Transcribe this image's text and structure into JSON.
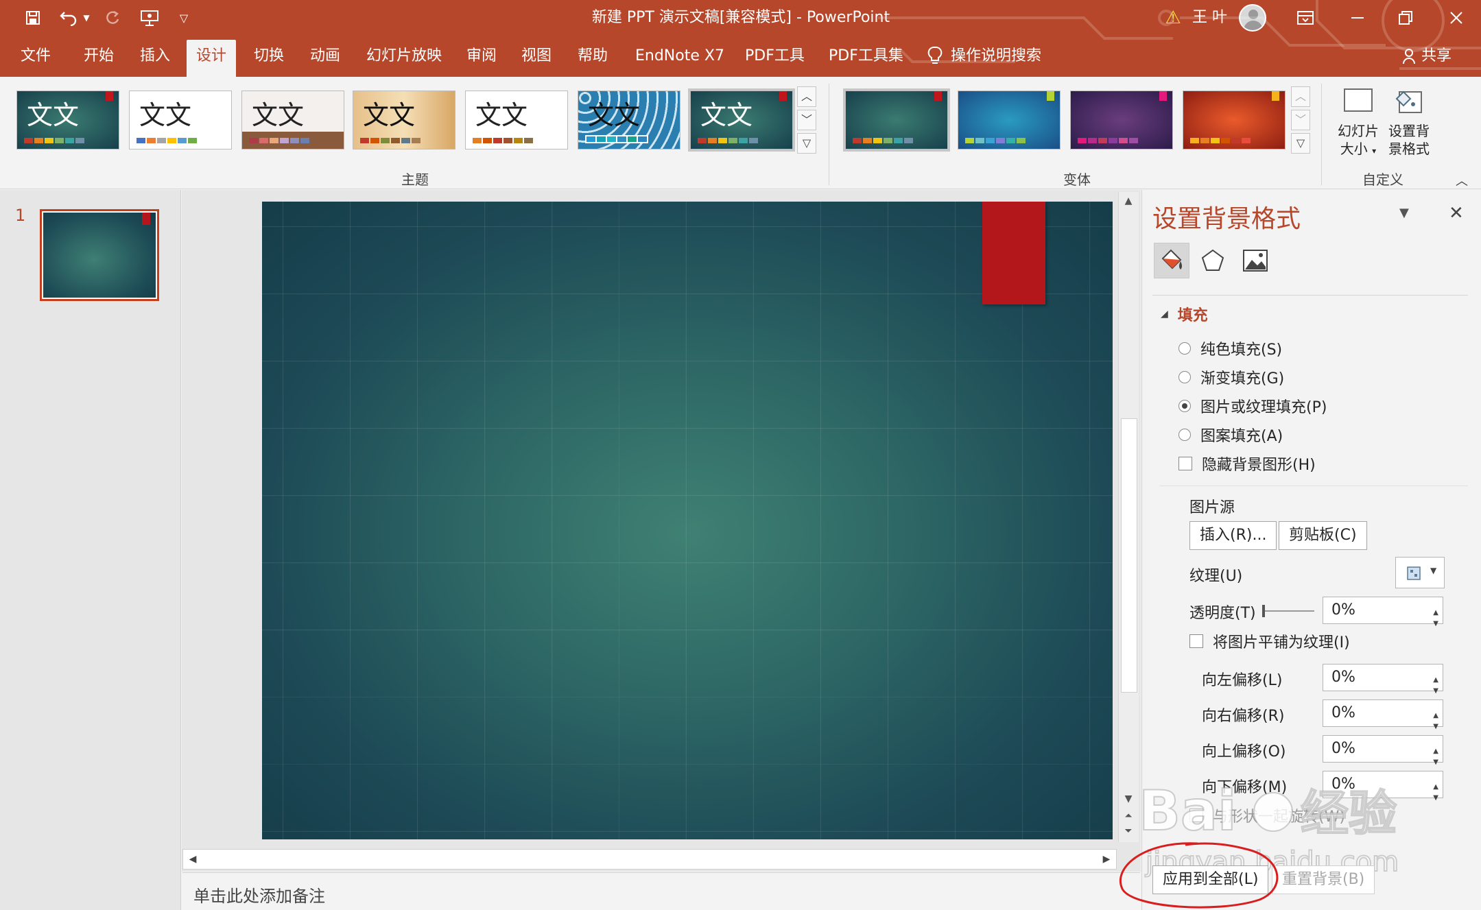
{
  "title_bar": {
    "document_title": "新建 PPT 演示文稿[兼容模式]  -  PowerPoint",
    "user_name": "王 叶",
    "quick_access": [
      "save-icon",
      "undo-icon",
      "redo-icon",
      "present-from-start-icon",
      "customize-qat-icon"
    ],
    "window_controls": [
      "ribbon-display-options-icon",
      "minimize-icon",
      "restore-icon",
      "close-icon"
    ]
  },
  "tabs": [
    {
      "label": "文件",
      "active": false
    },
    {
      "label": "开始",
      "active": false
    },
    {
      "label": "插入",
      "active": false
    },
    {
      "label": "设计",
      "active": true
    },
    {
      "label": "切换",
      "active": false
    },
    {
      "label": "动画",
      "active": false
    },
    {
      "label": "幻灯片放映",
      "active": false
    },
    {
      "label": "审阅",
      "active": false
    },
    {
      "label": "视图",
      "active": false
    },
    {
      "label": "帮助",
      "active": false
    },
    {
      "label": "EndNote X7",
      "active": false
    },
    {
      "label": "PDF工具",
      "active": false
    },
    {
      "label": "PDF工具集",
      "active": false
    }
  ],
  "tell_me": "操作说明搜索",
  "share": "共享",
  "ribbon": {
    "themes_group_label": "主题",
    "variants_group_label": "变体",
    "customize_group_label": "自定义",
    "theme_text": "文文",
    "slide_size_label_1": "幻灯片",
    "slide_size_label_2": "大小",
    "format_bg_label_1": "设置背",
    "format_bg_label_2": "景格式",
    "accent_color": "#b7472a"
  },
  "slides": {
    "count_label": "1"
  },
  "notes_placeholder": "单击此处添加备注",
  "format_pane": {
    "title": "设置背景格式",
    "section_fill": "填充",
    "options": [
      {
        "label": "纯色填充(S)",
        "selected": false
      },
      {
        "label": "渐变填充(G)",
        "selected": false
      },
      {
        "label": "图片或纹理填充(P)",
        "selected": true
      },
      {
        "label": "图案填充(A)",
        "selected": false
      }
    ],
    "hide_bg_graphics": "隐藏背景图形(H)",
    "picture_source": "图片源",
    "insert_btn": "插入(R)...",
    "clipboard_btn": "剪贴板(C)",
    "texture_label": "纹理(U)",
    "transparency_label": "透明度(T)",
    "transparency_value": "0%",
    "tile_label": "将图片平铺为纹理(I)",
    "offset_left_label": "向左偏移(L)",
    "offset_left_value": "0%",
    "offset_right_label": "向右偏移(R)",
    "offset_right_value": "0%",
    "offset_top_label": "向上偏移(O)",
    "offset_top_value": "0%",
    "offset_bottom_label": "向下偏移(M)",
    "offset_bottom_value": "0%",
    "rotate_label": "与形状一起旋转(W)",
    "apply_all_btn": "应用到全部(L)",
    "reset_btn": "重置背景(B)"
  }
}
